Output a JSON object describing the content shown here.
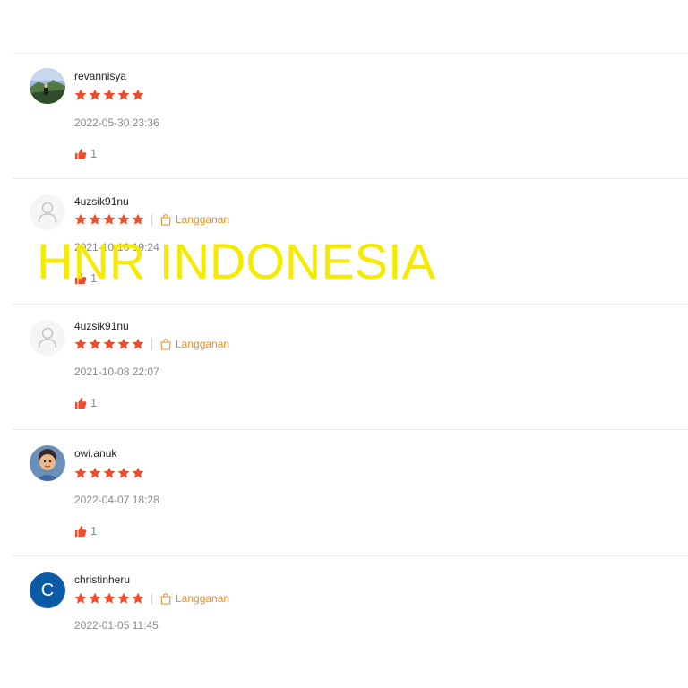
{
  "watermark": "HNR INDONESIA",
  "reviews": [
    {
      "username": "revannisya",
      "stars": 5,
      "badge": "",
      "date": "2022-05-30 23:36",
      "likes": "1"
    },
    {
      "username": "4uzsik91nu",
      "stars": 5,
      "badge": "Langganan",
      "date": "2021-10-10 19:24",
      "likes": "1"
    },
    {
      "username": "4uzsik91nu",
      "stars": 5,
      "badge": "Langganan",
      "date": "2021-10-08 22:07",
      "likes": "1"
    },
    {
      "username": "owi.anuk",
      "stars": 5,
      "badge": "",
      "date": "2022-04-07 18:28",
      "likes": "1"
    },
    {
      "username": "christinheru",
      "avatar_letter": "C",
      "stars": 5,
      "badge": "Langganan",
      "date": "2022-01-05 11:45",
      "likes": ""
    }
  ],
  "colors": {
    "star": "#ee4d2d",
    "badge": "#e4902f",
    "like": "#ee4d2d",
    "avatar_letter_bg": "#0a5aa6",
    "watermark": "#f5ea00"
  },
  "icons": {
    "star": "star-icon",
    "like": "thumbs-up-icon",
    "badge": "shopping-bag-icon",
    "placeholder_avatar": "user-silhouette-icon"
  }
}
